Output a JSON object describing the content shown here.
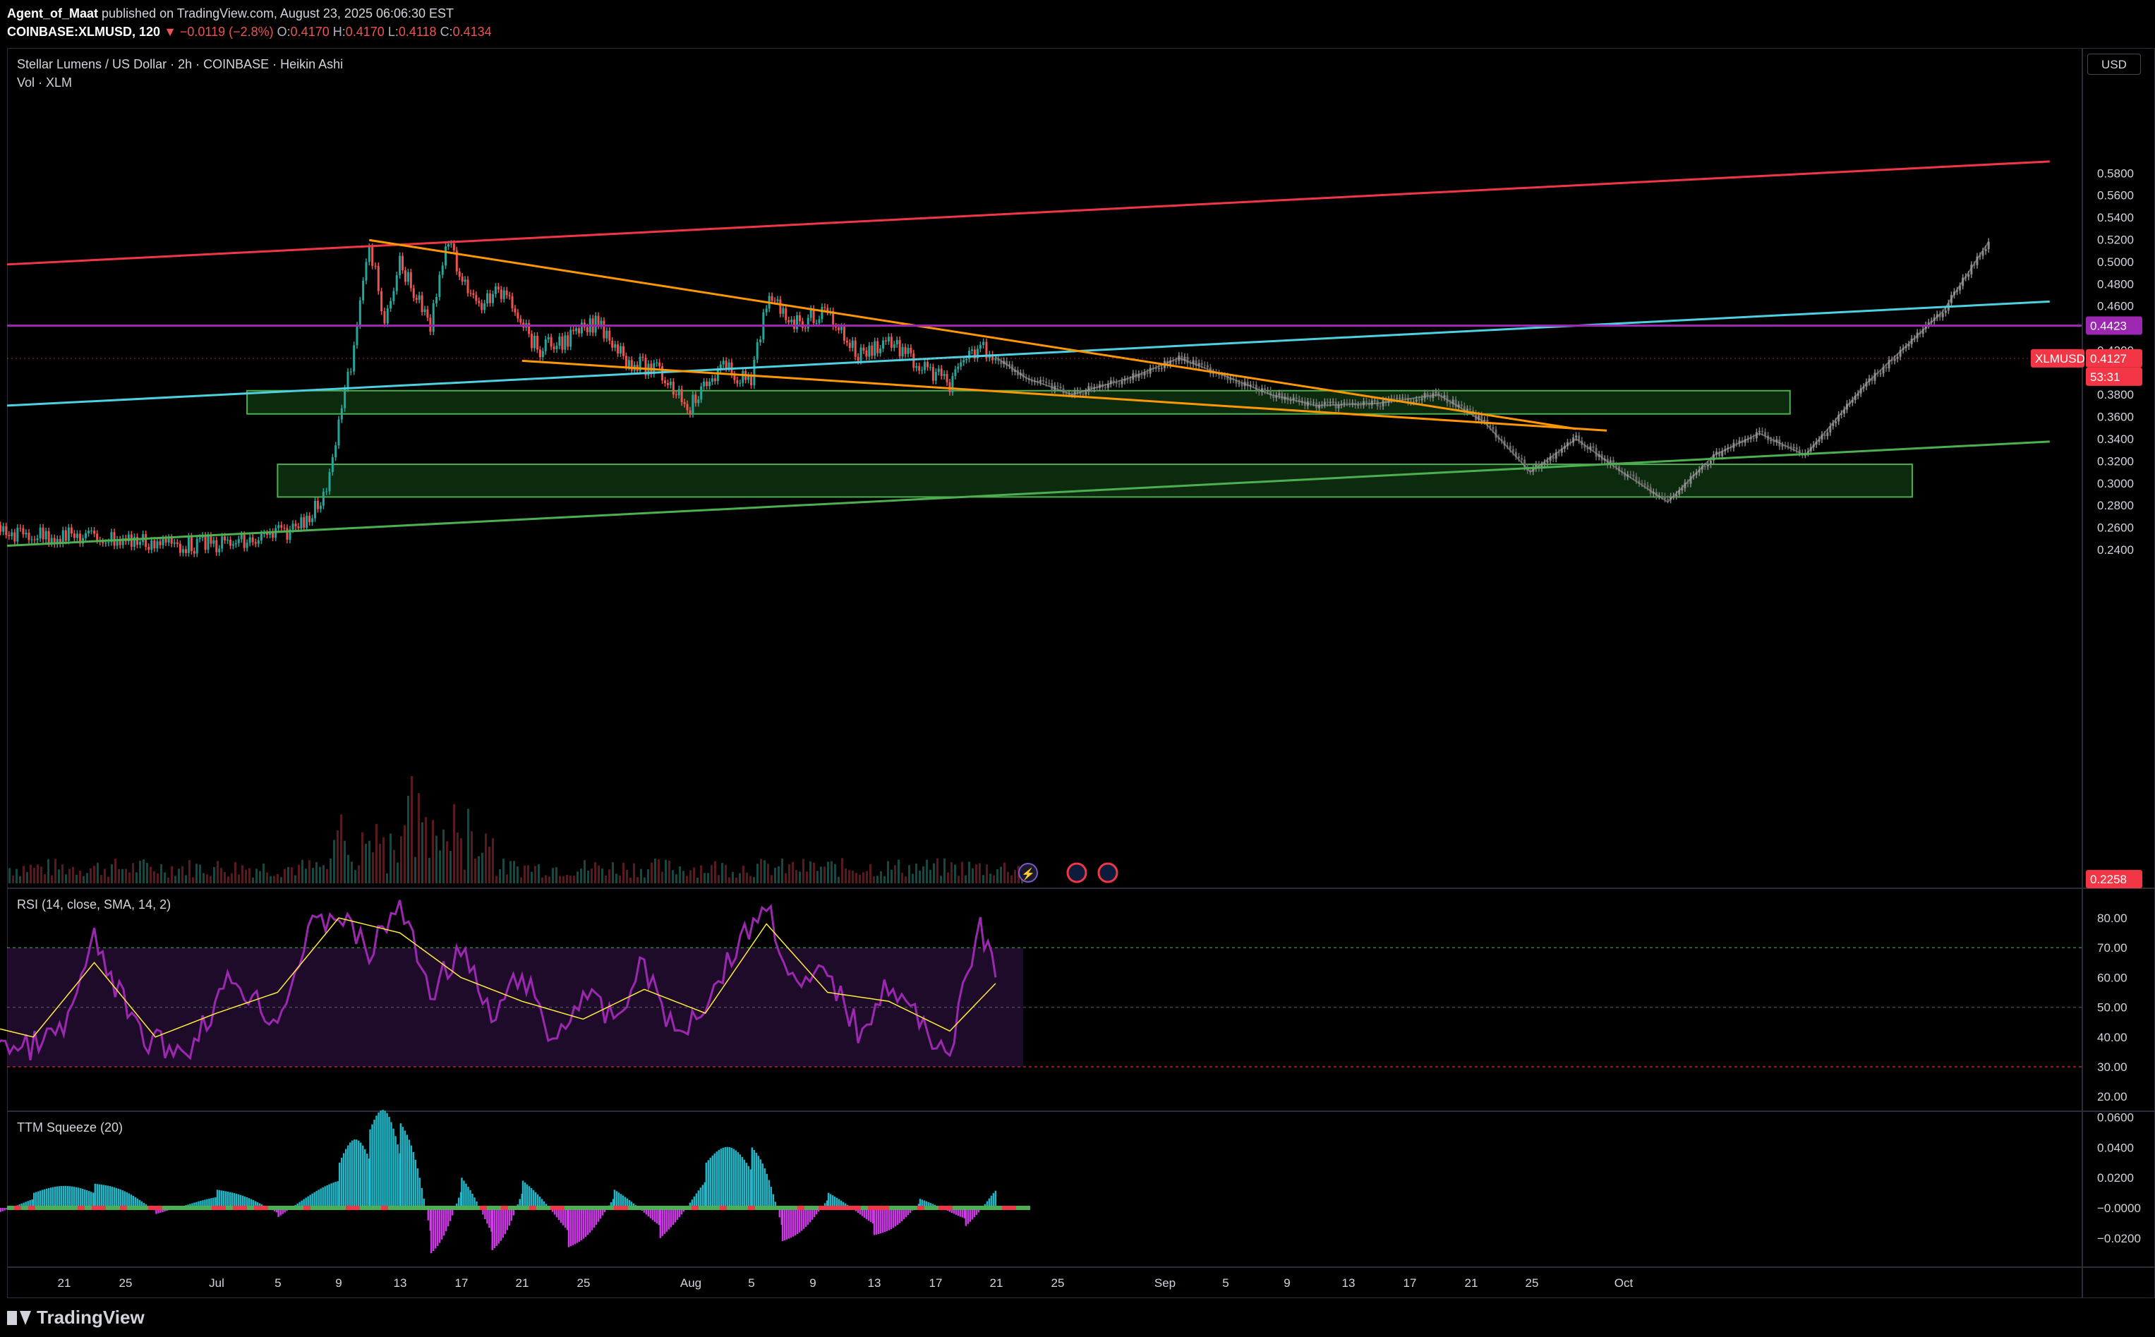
{
  "header": {
    "author": "Agent_of_Maat",
    "published": "published on TradingView.com, August 23, 2025 06:06:30 EST",
    "symbol_line": "COINBASE:XLMUSD, 120",
    "change": "▼ −0.0119 (−2.8%)",
    "o_label": "O:",
    "o": "0.4170",
    "h_label": "H:",
    "h": "0.4170",
    "l_label": "L:",
    "l": "0.4118",
    "c_label": "C:",
    "c": "0.4134"
  },
  "legend": {
    "title": "Stellar Lumens / US Dollar · 2h · COINBASE · Heikin Ashi",
    "volume": "Vol · XLM"
  },
  "currency_button": "USD",
  "panes": {
    "rsi_label": "RSI (14, close, SMA, 14, 2)",
    "ttm_label": "TTM Squeeze (20)"
  },
  "brand": "TradingView",
  "chart_data": [
    {
      "type": "line",
      "title": "Stellar Lumens / US Dollar · 2h · COINBASE · Heikin Ashi",
      "y_ticks": [
        "0.5800",
        "0.5600",
        "0.5400",
        "0.5200",
        "0.5000",
        "0.4800",
        "0.4600",
        "0.4400",
        "0.4200",
        "0.4000",
        "0.3800",
        "0.3600",
        "0.3400",
        "0.3200",
        "0.3000",
        "0.2800",
        "0.2600",
        "0.2400"
      ],
      "x_ticks": [
        "21",
        "25",
        "Jul",
        "5",
        "9",
        "13",
        "17",
        "21",
        "25",
        "Aug",
        "5",
        "9",
        "13",
        "17",
        "21",
        "25",
        "Sep",
        "5",
        "9",
        "13",
        "17",
        "21",
        "25",
        "Oct"
      ],
      "price_labels": [
        {
          "text": "0.4423",
          "value": 0.4423,
          "color": "#9c27b0"
        },
        {
          "text": "XLMUSD",
          "value": 0.4127,
          "color": "#f23645"
        },
        {
          "text": "0.4127",
          "value": 0.4127,
          "color": "#f23645"
        },
        {
          "text": "53:31",
          "value": 0.4127,
          "color": "#f23645"
        },
        {
          "text": "0.2258",
          "value": 0.2258,
          "color": "#f23645"
        }
      ],
      "series": [
        {
          "name": "",
          "kind": "price_actual",
          "color": "#26a69a",
          "x": [
            "Jun 17",
            "Jun 25",
            "Jul 1",
            "Jul 5",
            "Jul 8",
            "Jul 10",
            "Jul 11",
            "Jul 12",
            "Jul 13",
            "Jul 14",
            "Jul 15",
            "Jul 17",
            "Jul 18",
            "Jul 20",
            "Jul 22",
            "Jul 24",
            "Jul 26",
            "Jul 28",
            "Jul 30",
            "Aug 1",
            "Aug 3",
            "Aug 5",
            "Aug 7",
            "Aug 8",
            "Aug 10",
            "Aug 12",
            "Aug 14",
            "Aug 16",
            "Aug 18",
            "Aug 20",
            "Aug 22",
            "Aug 23"
          ],
          "y": [
            0.256,
            0.251,
            0.244,
            0.246,
            0.258,
            0.285,
            0.355,
            0.42,
            0.52,
            0.44,
            0.5,
            0.44,
            0.52,
            0.46,
            0.475,
            0.42,
            0.43,
            0.445,
            0.41,
            0.4,
            0.37,
            0.405,
            0.39,
            0.465,
            0.445,
            0.455,
            0.415,
            0.43,
            0.405,
            0.39,
            0.425,
            0.413
          ]
        },
        {
          "name": "",
          "kind": "price_projection",
          "color": "#9e9e9e",
          "x": [
            "Aug 23",
            "Aug 25",
            "Aug 28",
            "Sep 1",
            "Sep 4",
            "Sep 7",
            "Sep 10",
            "Sep 13",
            "Sep 17",
            "Sep 21",
            "Sep 24",
            "Sep 27",
            "Sep 30",
            "Oct 3",
            "Oct 6",
            "Oct 9",
            "Oct 12",
            "Oct 15",
            "Oct 19",
            "Oct 24",
            "Oct 27"
          ],
          "y": [
            0.414,
            0.395,
            0.38,
            0.396,
            0.413,
            0.397,
            0.38,
            0.37,
            0.372,
            0.38,
            0.355,
            0.31,
            0.34,
            0.31,
            0.283,
            0.325,
            0.345,
            0.325,
            0.39,
            0.455,
            0.518
          ]
        }
      ],
      "trendlines": [
        {
          "name": "",
          "color": "#f23645",
          "from": [
            "Jun 17",
            0.4975
          ],
          "to": [
            "Oct 31",
            0.5905
          ]
        },
        {
          "name": "",
          "color": "#4dd0e1",
          "from": [
            "Jun 17",
            0.37
          ],
          "to": [
            "Oct 31",
            0.464
          ]
        },
        {
          "name": "",
          "color": "#4caf50",
          "from": [
            "Jun 17",
            0.2435
          ],
          "to": [
            "Oct 31",
            0.3375
          ]
        },
        {
          "name": "",
          "color": "#ff9800",
          "from": [
            "Jul 13",
            0.5195
          ],
          "to": [
            "Sep 30",
            0.349
          ]
        },
        {
          "name": "",
          "color": "#ff9800",
          "from": [
            "Jul 23",
            0.4105
          ],
          "to": [
            "Oct 2",
            0.3475
          ]
        },
        {
          "name": "",
          "color": "#9c27b0",
          "horizontal": 0.4423
        }
      ],
      "zones": [
        {
          "color": "#1b5e20",
          "from": "Jul 5",
          "to": "Oct 14",
          "top": 0.3835,
          "bottom": 0.3625
        },
        {
          "color": "#1b5e20",
          "from": "Jul 7",
          "to": "Oct 22",
          "top": 0.317,
          "bottom": 0.2875
        }
      ],
      "ylim": [
        0.2258,
        0.5935
      ]
    },
    {
      "type": "line",
      "title": "RSI (14, close, SMA, 14, 2)",
      "y_ticks": [
        "80.00",
        "70.00",
        "60.00",
        "50.00",
        "40.00",
        "30.00",
        "20.00"
      ],
      "ylim": [
        16,
        92
      ],
      "bands": {
        "upper": 70,
        "middle": 50,
        "lower": 30
      },
      "series": [
        {
          "name": "",
          "color": "#9c27b0",
          "x": [
            "Jun 17",
            "Jun 20",
            "Jun 23",
            "Jun 25",
            "Jun 28",
            "Jul 1",
            "Jul 4",
            "Jul 7",
            "Jul 9",
            "Jul 11",
            "Jul 13",
            "Jul 15",
            "Jul 17",
            "Jul 19",
            "Jul 21",
            "Jul 23",
            "Jul 25",
            "Jul 27",
            "Jul 29",
            "Jul 31",
            "Aug 2",
            "Aug 4",
            "Aug 6",
            "Aug 8",
            "Aug 10",
            "Aug 12",
            "Aug 14",
            "Aug 16",
            "Aug 18",
            "Aug 20",
            "Aug 22",
            "Aug 23"
          ],
          "y": [
            48,
            35,
            42,
            72,
            40,
            35,
            60,
            45,
            75,
            82,
            68,
            85,
            55,
            70,
            45,
            62,
            38,
            55,
            45,
            65,
            40,
            52,
            70,
            85,
            55,
            62,
            42,
            58,
            45,
            35,
            78,
            60
          ]
        },
        {
          "name": "",
          "color": "#ffeb3b",
          "x": [
            "Jun 17",
            "Jun 21",
            "Jun 25",
            "Jun 29",
            "Jul 3",
            "Jul 7",
            "Jul 11",
            "Jul 15",
            "Jul 19",
            "Jul 23",
            "Jul 27",
            "Jul 31",
            "Aug 4",
            "Aug 8",
            "Aug 12",
            "Aug 16",
            "Aug 20",
            "Aug 23"
          ],
          "y": [
            45,
            40,
            65,
            40,
            48,
            55,
            80,
            75,
            60,
            52,
            46,
            56,
            48,
            78,
            55,
            52,
            42,
            58
          ]
        }
      ]
    },
    {
      "type": "bar",
      "title": "TTM Squeeze (20)",
      "y_ticks": [
        "0.0600",
        "0.0400",
        "0.0200",
        "−0.0000",
        "−0.0200"
      ],
      "ylim": [
        -0.032,
        0.063
      ],
      "colors": {
        "up": "#26c6da",
        "down": "#e040fb",
        "squeeze_on": "#f23645",
        "squeeze_off": "#4caf50"
      },
      "x": [
        "Jun 17",
        "Jun 21",
        "Jun 25",
        "Jun 29",
        "Jul 3",
        "Jul 7",
        "Jul 11",
        "Jul 13",
        "Jul 15",
        "Jul 17",
        "Jul 19",
        "Jul 21",
        "Jul 23",
        "Jul 26",
        "Jul 29",
        "Aug 1",
        "Aug 4",
        "Aug 7",
        "Aug 9",
        "Aug 12",
        "Aug 15",
        "Aug 18",
        "Aug 21",
        "Aug 23"
      ],
      "values": [
        -0.008,
        0.01,
        0.016,
        -0.004,
        0.012,
        -0.006,
        0.03,
        0.052,
        0.056,
        -0.03,
        0.02,
        -0.028,
        0.018,
        -0.026,
        0.012,
        -0.02,
        0.03,
        0.04,
        -0.022,
        0.01,
        -0.018,
        0.006,
        -0.012,
        0.02
      ]
    }
  ]
}
